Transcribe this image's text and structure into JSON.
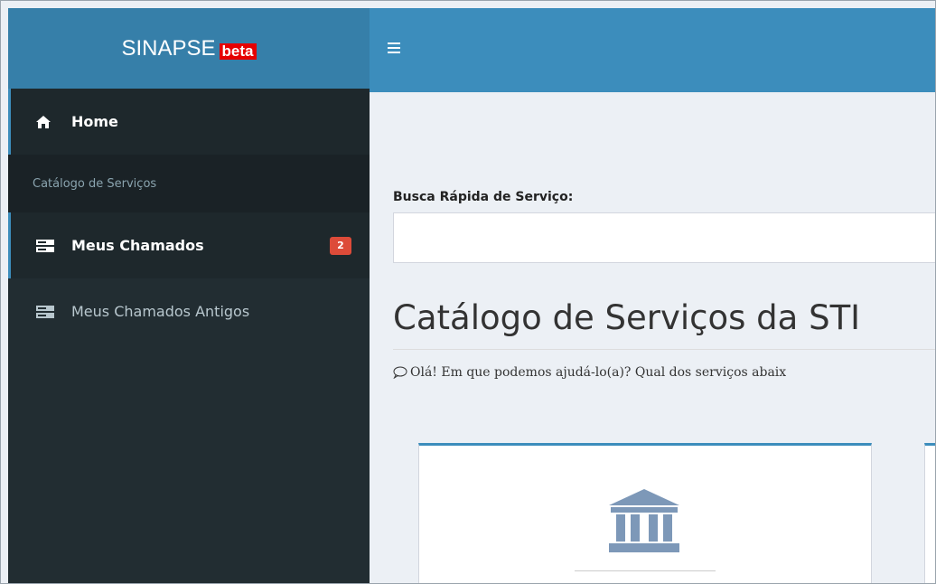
{
  "brand": {
    "name": "SINAPSE",
    "badge": "beta"
  },
  "sidebar": {
    "home_label": "Home",
    "section_header": "Catálogo de Serviços",
    "items": [
      {
        "label": "Meus Chamados",
        "badge": "2"
      },
      {
        "label": "Meus Chamados Antigos"
      }
    ]
  },
  "search": {
    "label": "Busca Rápida de Serviço:",
    "value": "",
    "placeholder": ""
  },
  "main": {
    "title": "Catálogo de Serviços da STI",
    "subtitle": "Olá! Em que podemos ajudá-lo(a)? Qual dos serviços abaix"
  },
  "icons": {
    "menu": "hamburger-icon",
    "home": "home-icon",
    "chamados": "server-icon",
    "chat": "chat-bubble-icon",
    "card": "bank-icon"
  },
  "colors": {
    "header": "#3c8dbc",
    "logo_bg": "#367fa9",
    "sidebar": "#222d32",
    "badge": "#dd4b39",
    "beta": "#e60000"
  }
}
